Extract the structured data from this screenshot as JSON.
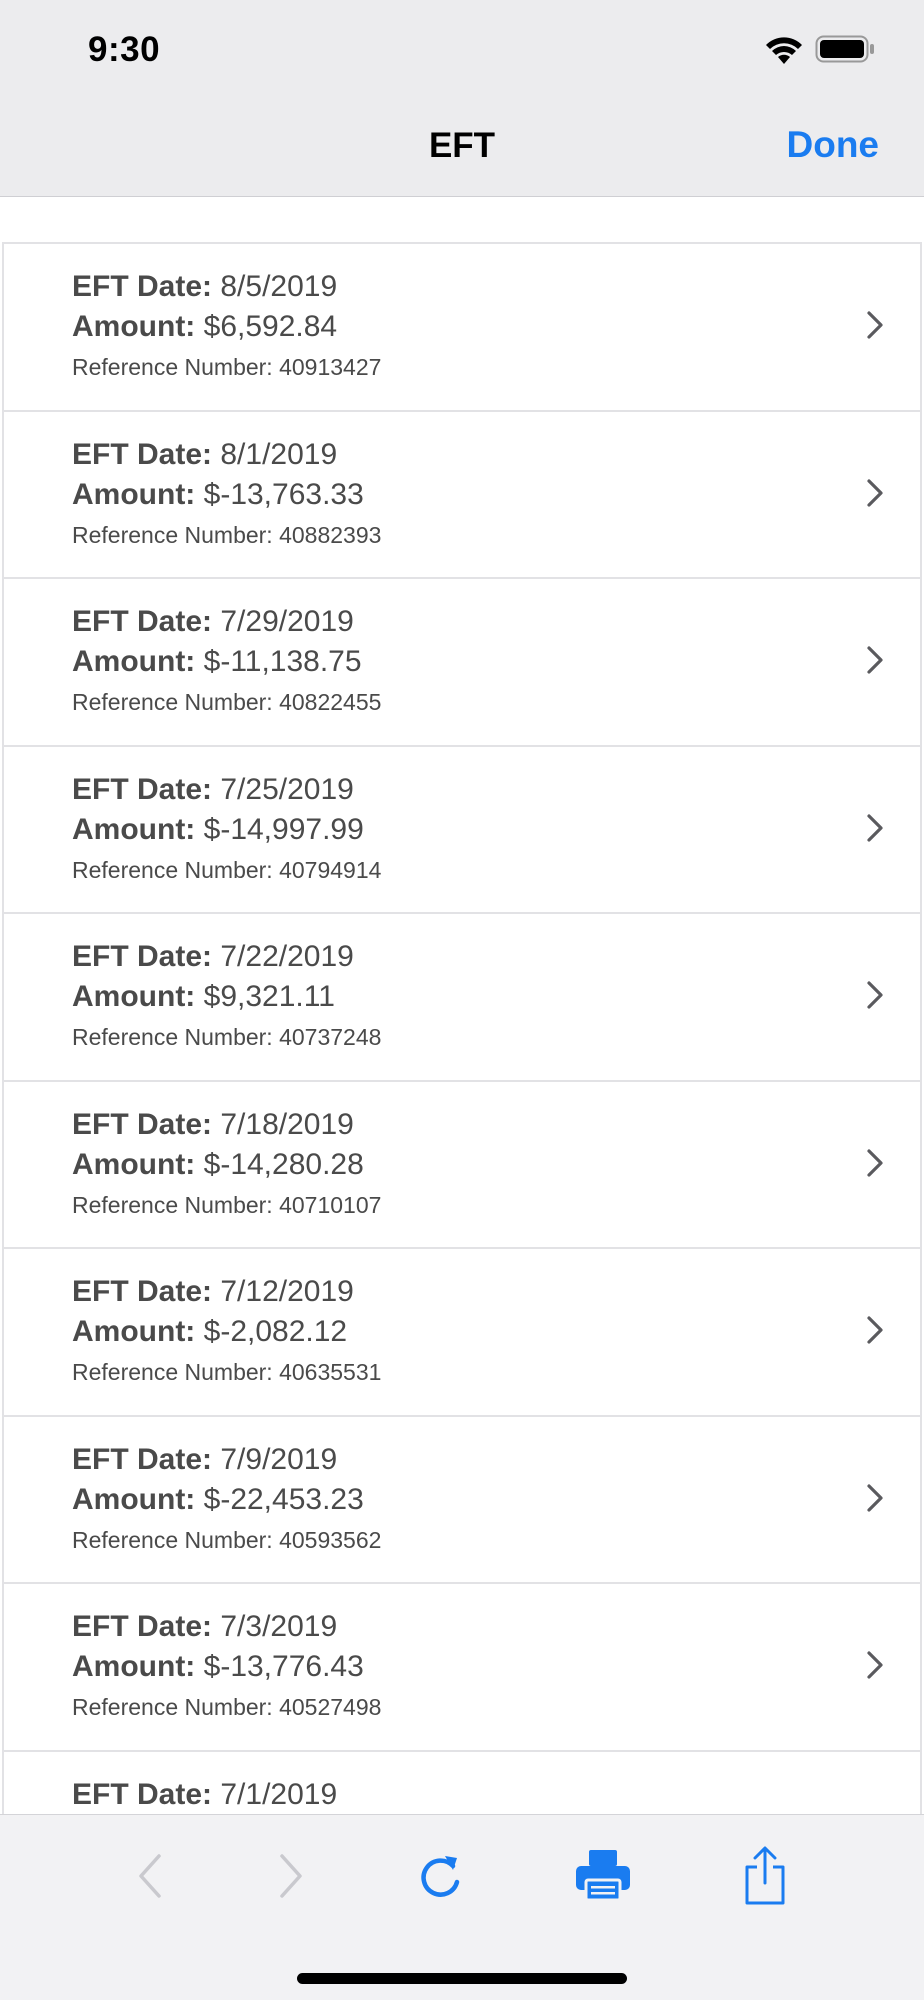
{
  "status_bar": {
    "time": "9:30"
  },
  "nav": {
    "title": "EFT",
    "done_label": "Done"
  },
  "labels": {
    "date": "EFT Date:",
    "amount": "Amount:",
    "reference": "Reference Number:"
  },
  "rows": [
    {
      "date": "8/5/2019",
      "amount": "$6,592.84",
      "reference": "40913427"
    },
    {
      "date": "8/1/2019",
      "amount": "$-13,763.33",
      "reference": "40882393"
    },
    {
      "date": "7/29/2019",
      "amount": "$-11,138.75",
      "reference": "40822455"
    },
    {
      "date": "7/25/2019",
      "amount": "$-14,997.99",
      "reference": "40794914"
    },
    {
      "date": "7/22/2019",
      "amount": "$9,321.11",
      "reference": "40737248"
    },
    {
      "date": "7/18/2019",
      "amount": "$-14,280.28",
      "reference": "40710107"
    },
    {
      "date": "7/12/2019",
      "amount": "$-2,082.12",
      "reference": "40635531"
    },
    {
      "date": "7/9/2019",
      "amount": "$-22,453.23",
      "reference": "40593562"
    },
    {
      "date": "7/3/2019",
      "amount": "$-13,776.43",
      "reference": "40527498"
    },
    {
      "date": "7/1/2019"
    }
  ],
  "toolbar": {
    "icons": [
      "back-icon",
      "forward-icon",
      "refresh-icon",
      "print-icon",
      "share-icon"
    ],
    "accent_color": "#1a7cf0",
    "disabled_color": "#c9c9ce"
  }
}
